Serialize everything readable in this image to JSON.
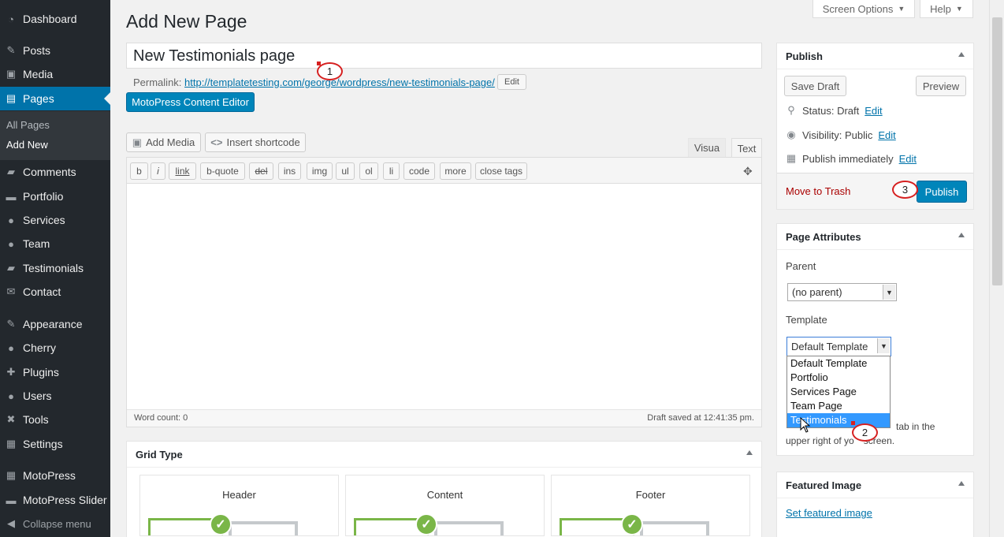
{
  "sidebar": {
    "items": [
      {
        "label": "Dashboard",
        "icon": "dashboard-icon",
        "glyph": "◔"
      },
      {
        "label": "Posts",
        "icon": "pin-icon",
        "glyph": "✎"
      },
      {
        "label": "Media",
        "icon": "media-icon",
        "glyph": "▣"
      },
      {
        "label": "Pages",
        "icon": "pages-icon",
        "glyph": "▤"
      },
      {
        "label": "Comments",
        "icon": "comments-icon",
        "glyph": "▰"
      },
      {
        "label": "Portfolio",
        "icon": "folder-icon",
        "glyph": "▬"
      },
      {
        "label": "Services",
        "icon": "lightbulb-icon",
        "glyph": "●"
      },
      {
        "label": "Team",
        "icon": "person-icon",
        "glyph": "●"
      },
      {
        "label": "Testimonials",
        "icon": "quote-icon",
        "glyph": "▰"
      },
      {
        "label": "Contact",
        "icon": "envelope-icon",
        "glyph": "✉"
      },
      {
        "label": "Appearance",
        "icon": "brush-icon",
        "glyph": "✎"
      },
      {
        "label": "Cherry",
        "icon": "cherry-icon",
        "glyph": "●"
      },
      {
        "label": "Plugins",
        "icon": "plugin-icon",
        "glyph": "✚"
      },
      {
        "label": "Users",
        "icon": "users-icon",
        "glyph": "●"
      },
      {
        "label": "Tools",
        "icon": "wrench-icon",
        "glyph": "✖"
      },
      {
        "label": "Settings",
        "icon": "settings-icon",
        "glyph": "▦"
      },
      {
        "label": "MotoPress",
        "icon": "motopress-icon",
        "glyph": "▦"
      },
      {
        "label": "MotoPress Slider",
        "icon": "slider-icon",
        "glyph": "▬"
      }
    ],
    "submenu": [
      "All Pages",
      "Add New"
    ],
    "collapse": "Collapse menu"
  },
  "top": {
    "screen_options": "Screen Options",
    "help": "Help"
  },
  "page_title": "Add New Page",
  "post_title": "New Testimonials page",
  "permalink": {
    "label": "Permalink:",
    "url": "http://templatetesting.com/george/wordpress/new-testimonials-page/",
    "edit": "Edit"
  },
  "motopress_button": "MotoPress Content Editor",
  "editor": {
    "add_media": "Add Media",
    "insert_shortcode": "Insert shortcode",
    "tab_visual": "Visua",
    "tab_text": "Text",
    "quicktags": [
      "b",
      "i",
      "link",
      "b-quote",
      "del",
      "ins",
      "img",
      "ul",
      "ol",
      "li",
      "code",
      "more",
      "close tags"
    ],
    "word_count": "Word count: 0",
    "draft_saved": "Draft saved at 12:41:35 pm."
  },
  "grid_type": {
    "title": "Grid Type",
    "columns": [
      "Header",
      "Content",
      "Footer"
    ]
  },
  "publish": {
    "title": "Publish",
    "save_draft": "Save Draft",
    "preview": "Preview",
    "status_label": "Status: Draft",
    "visibility_label": "Visibility: Public",
    "schedule_label": "Publish immediately",
    "edit": "Edit",
    "trash": "Move to Trash",
    "publish_button": "Publish"
  },
  "page_attributes": {
    "title": "Page Attributes",
    "parent_label": "Parent",
    "parent_value": "(no parent)",
    "template_label": "Template",
    "template_value": "Default Template",
    "template_options": [
      "Default Template",
      "Portfolio",
      "Services Page",
      "Team Page",
      "Testimonials"
    ],
    "selected_option": "Testimonials",
    "help_line1": "tab in the",
    "help_line2_a": "upper right of yo",
    "help_line2_b": "screen."
  },
  "featured_image": {
    "title": "Featured Image",
    "link": "Set featured image"
  },
  "callouts": [
    "1",
    "2",
    "3"
  ],
  "colors": {
    "sidebar": "#23282d",
    "accent": "#0073aa",
    "button_primary": "#0085ba",
    "callout": "#d62020",
    "grid_green": "#7ab648"
  }
}
